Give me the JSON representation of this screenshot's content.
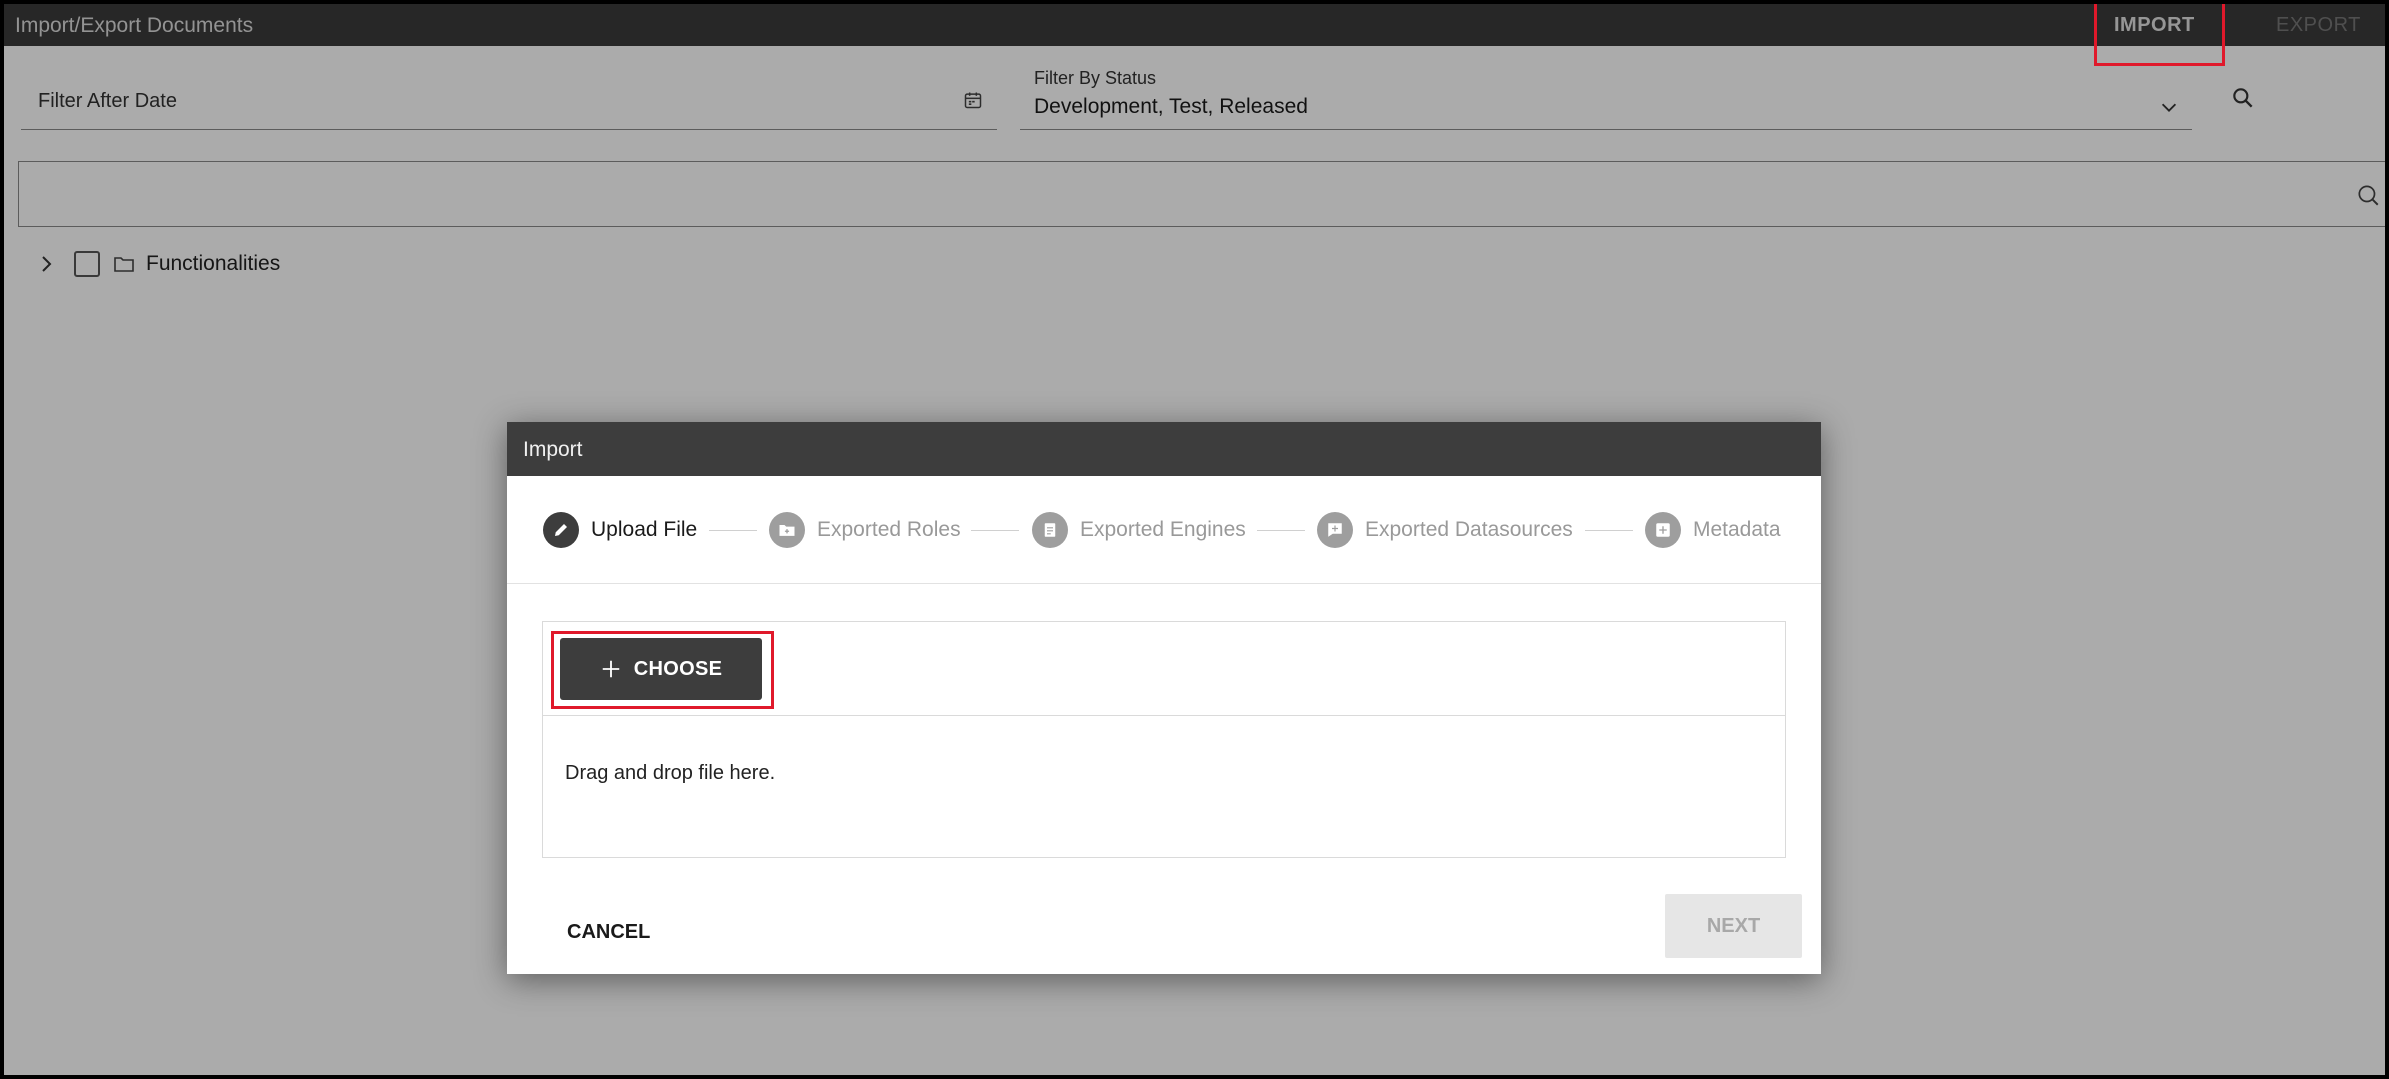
{
  "header": {
    "title": "Import/Export Documents",
    "import_label": "IMPORT",
    "export_label": "EXPORT"
  },
  "filters": {
    "date_label": "Filter After Date",
    "date_icon": "calendar-icon",
    "status_label": "Filter By Status",
    "status_value": "Development, Test, Released",
    "status_icon": "chevron-down-icon",
    "search_icon": "search-icon"
  },
  "tree": {
    "search_icon": "search-icon",
    "items": [
      {
        "label": "Functionalities",
        "icon": "folder-icon",
        "checked": false,
        "expanded": false
      }
    ]
  },
  "dialog": {
    "title": "Import",
    "steps": [
      {
        "label": "Upload File",
        "icon": "pencil-icon",
        "active": true
      },
      {
        "label": "Exported Roles",
        "icon": "folder-plus-icon",
        "active": false
      },
      {
        "label": "Exported Engines",
        "icon": "document-icon",
        "active": false
      },
      {
        "label": "Exported Datasources",
        "icon": "add-comment-icon",
        "active": false
      },
      {
        "label": "Metadata",
        "icon": "add-box-icon",
        "active": false
      }
    ],
    "choose_label": "CHOOSE",
    "drop_text": "Drag and drop file here.",
    "cancel_label": "CANCEL",
    "next_label": "NEXT"
  },
  "colors": {
    "header_bg": "#3b3b3b",
    "dialog_header_bg": "#3d3d3d",
    "highlight": "#e0192b",
    "overlay": "rgba(0,0,0,0.33)"
  }
}
